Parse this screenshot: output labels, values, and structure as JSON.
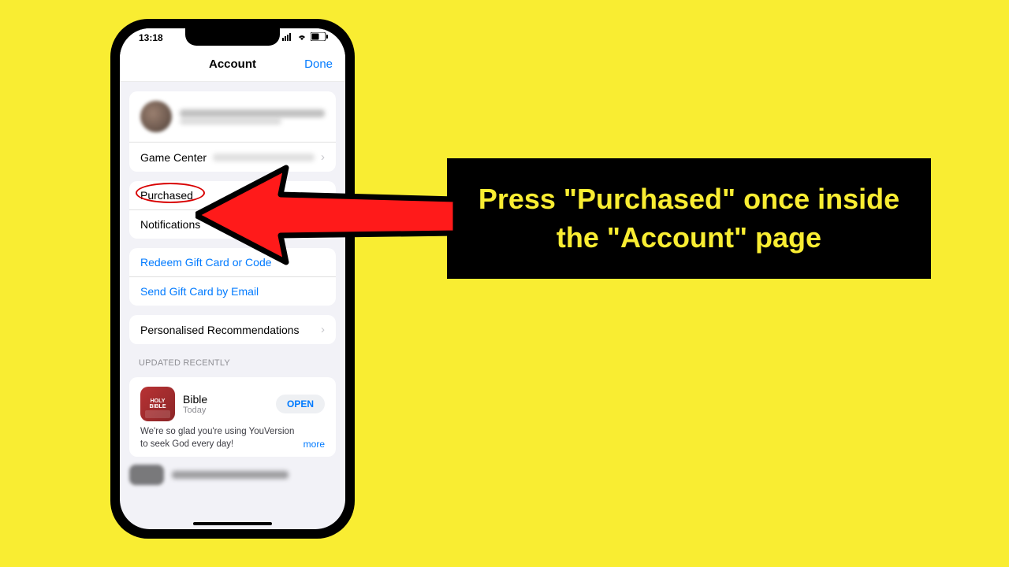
{
  "status": {
    "time": "13:18",
    "battery": "51"
  },
  "nav": {
    "title": "Account",
    "done": "Done"
  },
  "rows": {
    "game_center": "Game Center",
    "purchased": "Purchased",
    "notifications": "Notifications",
    "redeem": "Redeem Gift Card or Code",
    "send_gift": "Send Gift Card by Email",
    "personalised": "Personalised Recommendations"
  },
  "updated_header": "Updated Recently",
  "app": {
    "icon_line1": "HOLY",
    "icon_line2": "BIBLE",
    "name": "Bible",
    "subtitle": "Today",
    "open": "OPEN",
    "desc": "We're so glad you're using YouVersion to seek God every day!",
    "more": "more"
  },
  "instruction": "Press \"Purchased\" once inside the \"Account\" page"
}
